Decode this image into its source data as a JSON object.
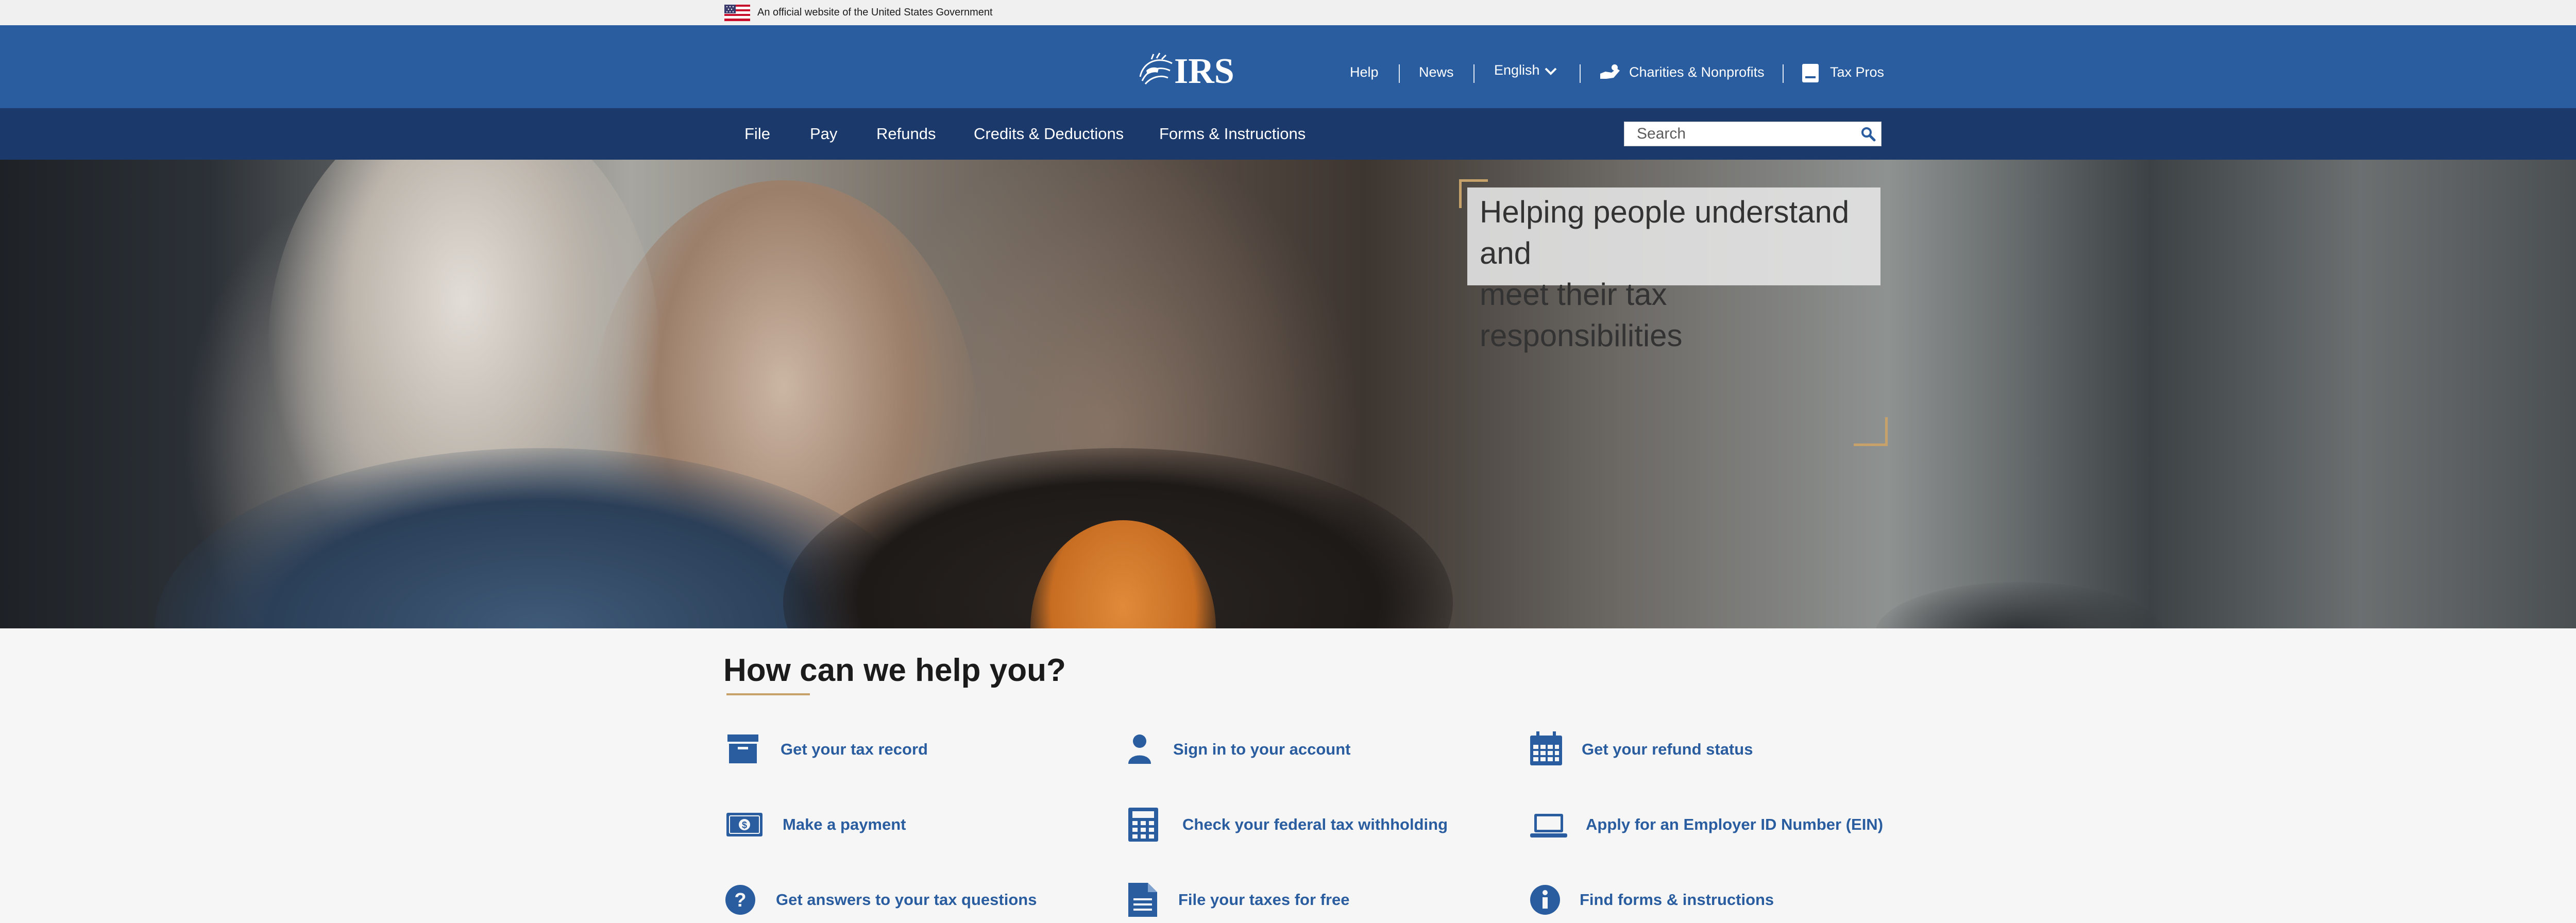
{
  "gov_banner": {
    "text": "An official website of the United States Government"
  },
  "header": {
    "logo_text": "IRS",
    "links": {
      "help": "Help",
      "news": "News",
      "language": "English",
      "charities": "Charities & Nonprofits",
      "tax_pros": "Tax Pros"
    }
  },
  "nav": {
    "items": [
      "File",
      "Pay",
      "Refunds",
      "Credits & Deductions",
      "Forms & Instructions"
    ],
    "search_placeholder": "Search"
  },
  "hero": {
    "line1": "Helping people understand and",
    "line2": "meet their tax responsibilities"
  },
  "help_section": {
    "heading": "How can we help you?",
    "tasks": [
      {
        "label": "Get your tax record",
        "icon": "archive-box-icon"
      },
      {
        "label": "Sign in to your account",
        "icon": "person-icon"
      },
      {
        "label": "Get your refund status",
        "icon": "calendar-icon"
      },
      {
        "label": "Make a payment",
        "icon": "dollar-bill-icon"
      },
      {
        "label": "Check your federal tax withholding",
        "icon": "calculator-icon"
      },
      {
        "label": "Apply for an Employer ID Number (EIN)",
        "icon": "laptop-icon"
      },
      {
        "label": "Get answers to your tax questions",
        "icon": "question-circle-icon"
      },
      {
        "label": "File your taxes for free",
        "icon": "document-icon"
      },
      {
        "label": "Find forms & instructions",
        "icon": "info-circle-icon"
      }
    ]
  },
  "colors": {
    "header_blue": "#2a5d9f",
    "nav_navy": "#1b3a6b",
    "link_blue": "#2a5d9f",
    "accent_gold": "#c6a16a"
  }
}
